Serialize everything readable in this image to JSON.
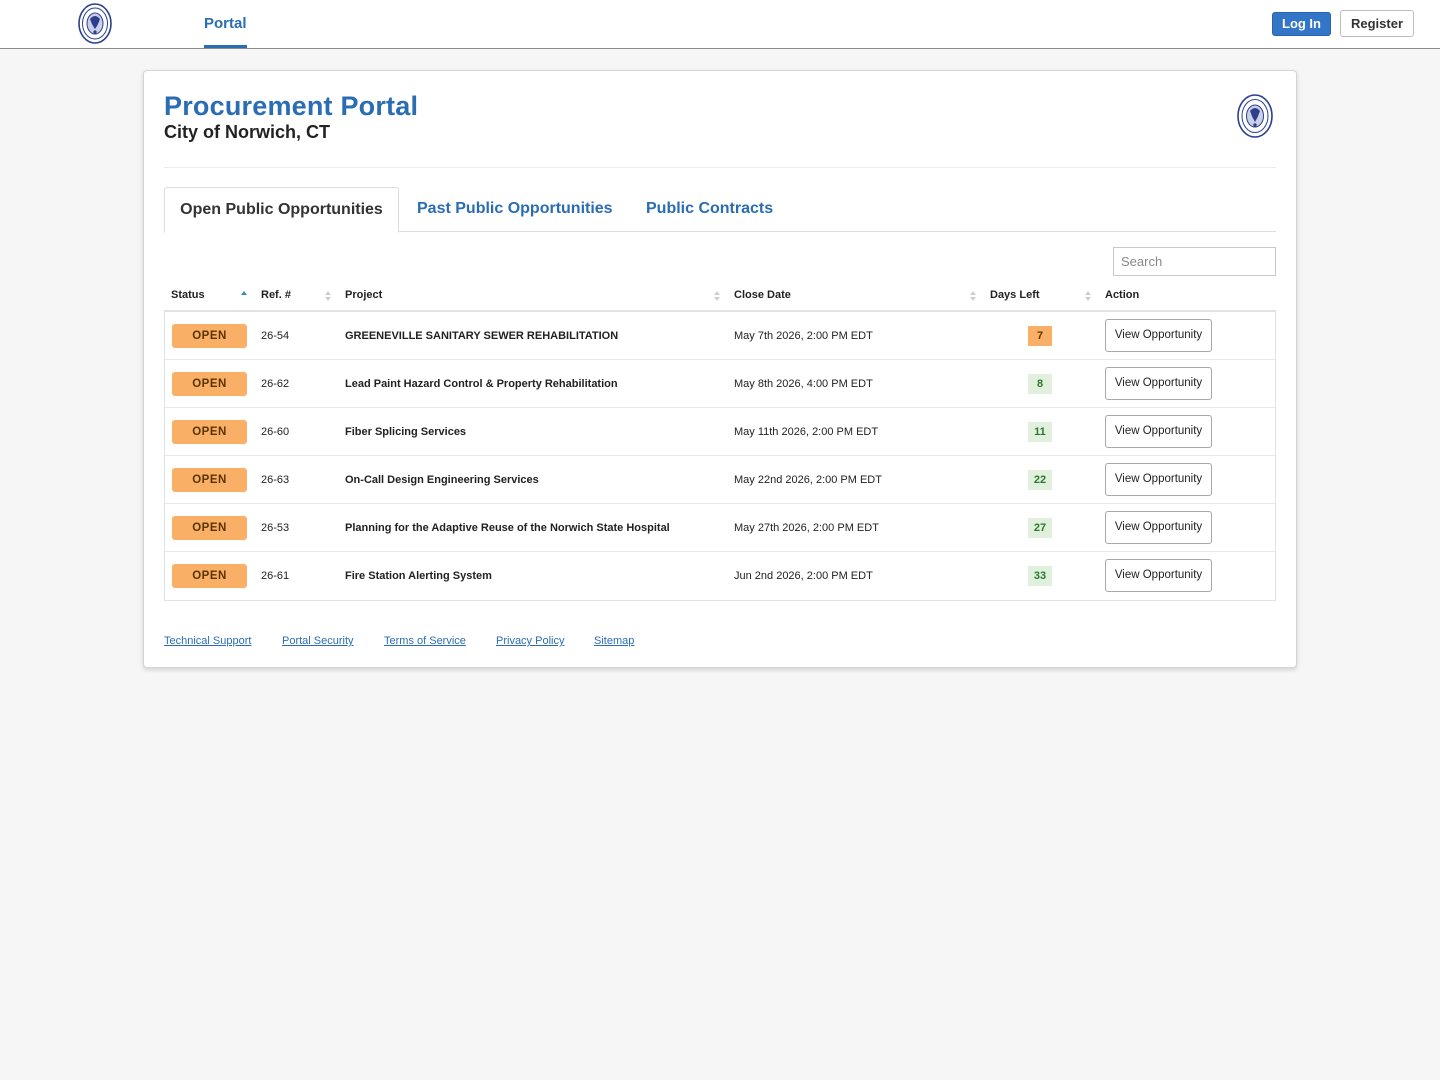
{
  "nav": {
    "portal_tab": "Portal",
    "login_label": "Log In",
    "register_label": "Register"
  },
  "header": {
    "title": "Procurement Portal",
    "subtitle": "City of Norwich, CT"
  },
  "tabs": [
    {
      "label": "Open Public Opportunities",
      "active": true
    },
    {
      "label": "Past Public Opportunities",
      "active": false
    },
    {
      "label": "Public Contracts",
      "active": false
    }
  ],
  "search": {
    "placeholder": "Search",
    "value": ""
  },
  "table": {
    "columns": [
      "Status",
      "Ref. #",
      "Project",
      "Close Date",
      "Days Left",
      "Action"
    ],
    "sorted_column": "Status",
    "rows": [
      {
        "status": "OPEN",
        "ref": "26-54",
        "project": "GREENEVILLE SANITARY SEWER REHABILITATION",
        "close_date": "May 7th 2026, 2:00 PM EDT",
        "days_left": "7",
        "action": "View Opportunity"
      },
      {
        "status": "OPEN",
        "ref": "26-62",
        "project": "Lead Paint Hazard Control & Property Rehabilitation",
        "close_date": "May 8th 2026, 4:00 PM EDT",
        "days_left": "8",
        "action": "View Opportunity"
      },
      {
        "status": "OPEN",
        "ref": "26-60",
        "project": "Fiber Splicing Services",
        "close_date": "May 11th 2026, 2:00 PM EDT",
        "days_left": "11",
        "action": "View Opportunity"
      },
      {
        "status": "OPEN",
        "ref": "26-63",
        "project": "On-Call Design Engineering Services",
        "close_date": "May 22nd 2026, 2:00 PM EDT",
        "days_left": "22",
        "action": "View Opportunity"
      },
      {
        "status": "OPEN",
        "ref": "26-53",
        "project": "Planning for the Adaptive Reuse of the Norwich State Hospital",
        "close_date": "May 27th 2026, 2:00 PM EDT",
        "days_left": "27",
        "action": "View Opportunity"
      },
      {
        "status": "OPEN",
        "ref": "26-61",
        "project": "Fire Station Alerting System",
        "close_date": "Jun 2nd 2026, 2:00 PM EDT",
        "days_left": "33",
        "action": "View Opportunity"
      }
    ]
  },
  "footer": {
    "links": [
      "Technical Support",
      "Portal Security",
      "Terms of Service",
      "Privacy Policy",
      "Sitemap"
    ]
  },
  "colors": {
    "accent": "#2a6db3",
    "status_open": "#f9b066",
    "days_ok_bg": "#e1f0dd",
    "days_urgent_bg": "#f9b066"
  },
  "icons": {
    "logo": "city-seal-icon",
    "sort": "sort-arrows-icon"
  }
}
